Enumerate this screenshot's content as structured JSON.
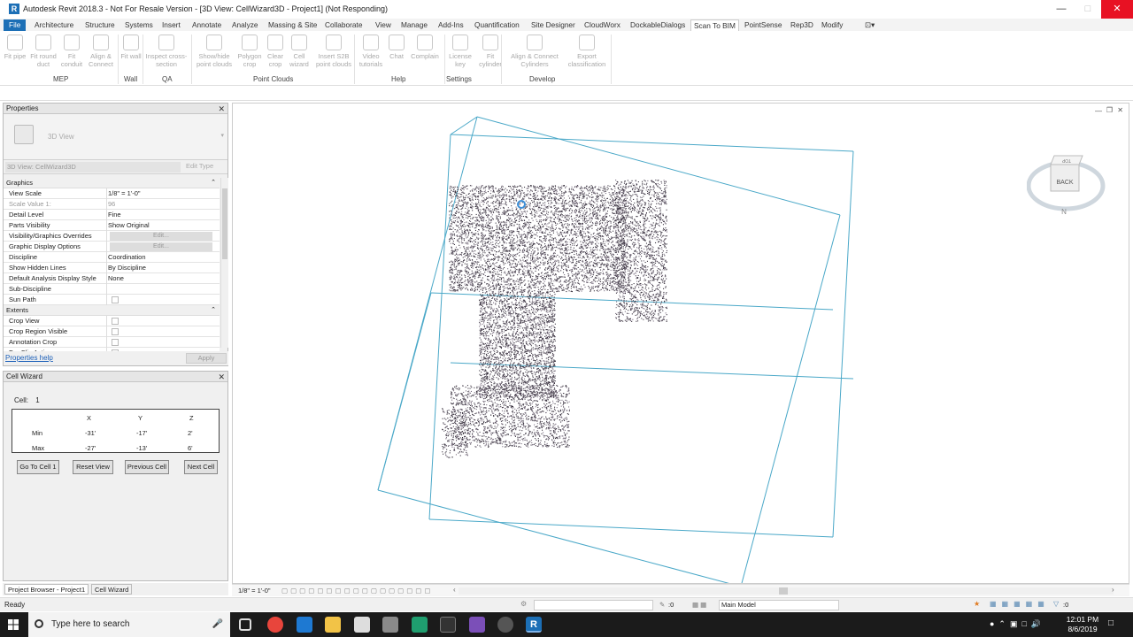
{
  "window": {
    "title": "Autodesk Revit 2018.3 - Not For Resale Version - [3D View: CellWizard3D - Project1] (Not Responding)",
    "logo": "R"
  },
  "menu": [
    "File",
    "Architecture",
    "Structure",
    "Systems",
    "Insert",
    "Annotate",
    "Analyze",
    "Massing & Site",
    "Collaborate",
    "View",
    "Manage",
    "Add-Ins",
    "Quantification",
    "Site Designer",
    "CloudWorx",
    "DockableDialogs",
    "Scan To BIM",
    "PointSense",
    "Rep3D",
    "Modify"
  ],
  "menu_active": "Scan To BIM",
  "ribbon": {
    "buttons": [
      "Fit pipe",
      "Fit round duct",
      "Fit conduit",
      "Align & Connect",
      "Fit wall",
      "Inspect cross-section",
      "Show/hide point clouds",
      "Polygon crop",
      "Clear crop",
      "Cell wizard",
      "Insert S2B point clouds",
      "Video tutorials",
      "Chat",
      "Complain",
      "License key",
      "Fit cylinder",
      "Align & Connect Cylinders",
      "Export classification"
    ],
    "groups": [
      "MEP",
      "Wall",
      "QA",
      "Point Clouds",
      "Help",
      "Settings",
      "Develop"
    ]
  },
  "properties": {
    "title": "Properties",
    "type_name": "3D View",
    "filter": "3D View: CellWizard3D",
    "edit_type": "Edit Type",
    "group_graphics": "Graphics",
    "rows_graphics": [
      {
        "k": "View Scale",
        "v": "1/8\" = 1'-0\""
      },
      {
        "k": "Scale Value    1:",
        "v": "96",
        "grey": true
      },
      {
        "k": "Detail Level",
        "v": "Fine"
      },
      {
        "k": "Parts Visibility",
        "v": "Show Original"
      },
      {
        "k": "Visibility/Graphics Overrides",
        "v": "Edit...",
        "btn": true
      },
      {
        "k": "Graphic Display Options",
        "v": "Edit...",
        "btn": true
      },
      {
        "k": "Discipline",
        "v": "Coordination"
      },
      {
        "k": "Show Hidden Lines",
        "v": "By Discipline"
      },
      {
        "k": "Default Analysis Display Style",
        "v": "None"
      },
      {
        "k": "Sub-Discipline",
        "v": ""
      },
      {
        "k": "Sun Path",
        "v": "",
        "chk": true
      }
    ],
    "group_extents": "Extents",
    "rows_extents": [
      {
        "k": "Crop View",
        "v": "",
        "chk": true
      },
      {
        "k": "Crop Region Visible",
        "v": "",
        "chk": true
      },
      {
        "k": "Annotation Crop",
        "v": "",
        "chk": true
      },
      {
        "k": "Far Clip Active",
        "v": "",
        "chk": true
      }
    ],
    "help": "Properties help",
    "apply": "Apply"
  },
  "cell_wizard": {
    "title": "Cell Wizard",
    "cell_label": "Cell:",
    "cell_value": "1",
    "headers": [
      "X",
      "Y",
      "Z"
    ],
    "rows": [
      {
        "label": "Min",
        "x": "-31'",
        "y": "-17'",
        "z": "2'"
      },
      {
        "label": "Max",
        "x": "-27'",
        "y": "-13'",
        "z": "6'"
      }
    ],
    "buttons": [
      "Go To Cell 1",
      "Reset View",
      "Previous Cell",
      "Next Cell"
    ]
  },
  "panel_tabs": [
    "Project Browser - Project1",
    "Cell Wizard"
  ],
  "view_scale": "1/8\" = 1'-0\"",
  "navcube": {
    "face": "BACK",
    "top": "TOP",
    "compass": "N"
  },
  "status": {
    "ready": "Ready",
    "model": "Main Model",
    "filter_count": ":0",
    "sel_count": ":0"
  },
  "taskbar": {
    "search": "Type here to search",
    "time": "12:01 PM",
    "date": "8/6/2019"
  },
  "colors": {
    "accent": "#1c6fb6",
    "box_line": "#4aa8c8",
    "cloud": "#3a3340"
  }
}
